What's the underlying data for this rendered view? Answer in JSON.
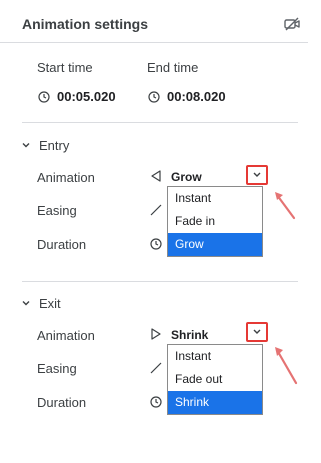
{
  "header": {
    "title": "Animation settings"
  },
  "timing": {
    "start_label": "Start time",
    "end_label": "End time",
    "start_value": "00:05.020",
    "end_value": "00:08.020"
  },
  "entry": {
    "title": "Entry",
    "animation_label": "Animation",
    "animation_value": "Grow",
    "easing_label": "Easing",
    "duration_label": "Duration",
    "options": [
      "Instant",
      "Fade in",
      "Grow"
    ]
  },
  "exit": {
    "title": "Exit",
    "animation_label": "Animation",
    "animation_value": "Shrink",
    "easing_label": "Easing",
    "duration_label": "Duration",
    "options": [
      "Instant",
      "Fade out",
      "Shrink"
    ]
  },
  "colors": {
    "accent": "#1a73e8",
    "highlight": "#e53935"
  }
}
